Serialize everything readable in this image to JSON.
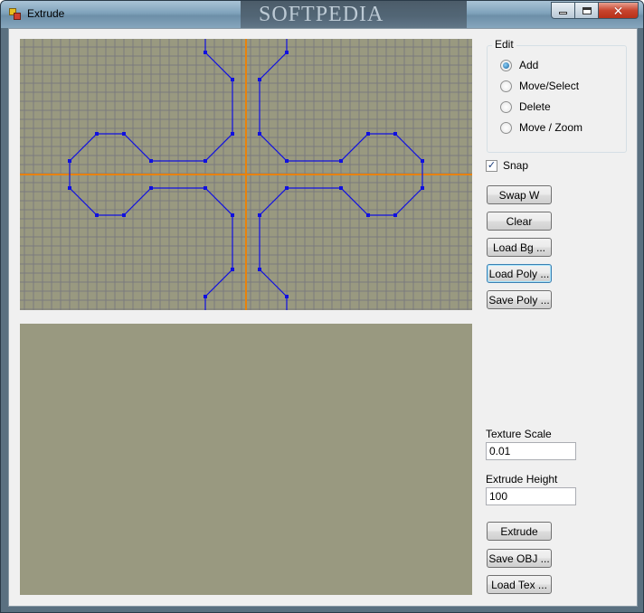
{
  "window": {
    "title": "Extrude",
    "watermark": "SOFTPEDIA",
    "controls": {
      "minimize": "minimize-icon",
      "maximize": "maximize-icon",
      "close": "close-icon"
    }
  },
  "colors": {
    "canvas_bg": "#999980",
    "grid_line": "#7a7a7e",
    "axis": "#e8820c",
    "polygon": "#1010e0"
  },
  "edit_group": {
    "title": "Edit",
    "options": [
      {
        "label": "Add",
        "selected": true
      },
      {
        "label": "Move/Select",
        "selected": false
      },
      {
        "label": "Delete",
        "selected": false
      },
      {
        "label": "Move / Zoom",
        "selected": false
      }
    ]
  },
  "snap": {
    "label": "Snap",
    "checked": true
  },
  "buttons": {
    "swap_w": "Swap W",
    "clear": "Clear",
    "load_bg": "Load Bg ...",
    "load_poly": "Load Poly ...",
    "save_poly": "Save Poly ...",
    "extrude": "Extrude",
    "save_obj": "Save OBJ ...",
    "load_tex": "Load Tex ..."
  },
  "texture_scale": {
    "label": "Texture Scale",
    "value": "0.01"
  },
  "extrude_height": {
    "label": "Extrude Height",
    "value": "100"
  }
}
